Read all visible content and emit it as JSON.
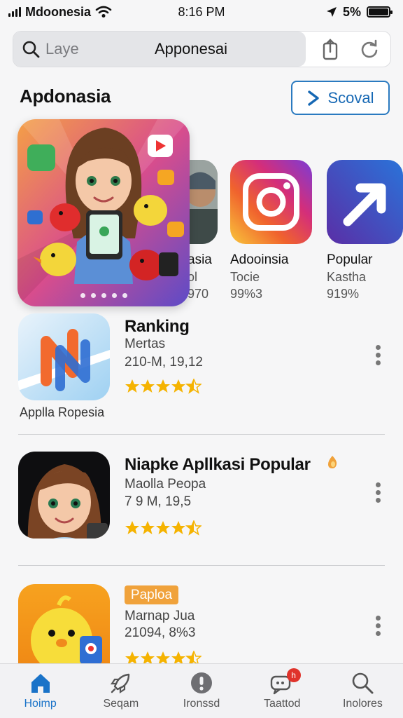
{
  "status_bar": {
    "carrier": "Mdoonesia",
    "time": "8:16 PM",
    "battery": "5%"
  },
  "search": {
    "placeholder": "Laye",
    "title": "Apponesai"
  },
  "section": {
    "title": "Apdonasia",
    "button_label": "Scoval"
  },
  "carousel": {
    "cards": [
      {
        "title": "asia",
        "line2": "ol",
        "line3": "970"
      },
      {
        "title": "Adooinsia",
        "line2": "Tocie",
        "line3": "99%3"
      },
      {
        "title": "Popular",
        "line2": "Kastha",
        "line3": "919%"
      }
    ],
    "page_dots": 5
  },
  "list": {
    "items": [
      {
        "name": "Ranking",
        "subtitle": "Mertas",
        "meta": "210-M, 19,12",
        "rating": 4.5,
        "caption": "Applla Ropesia"
      },
      {
        "name": "Niapke Apllkasi Popular",
        "subtitle": "Maolla Peopa",
        "meta": "7 9 M, 19,5",
        "rating": 4.5
      },
      {
        "name": "",
        "badge": "Paploa",
        "subtitle": "Marnap Jua",
        "meta": "21094, 8%3",
        "rating": 4.5
      }
    ]
  },
  "tabbar": {
    "tabs": [
      {
        "label": "Hoimp",
        "icon": "home-icon",
        "active": true
      },
      {
        "label": "Seqam",
        "icon": "rocket-icon",
        "active": false
      },
      {
        "label": "Ironssd",
        "icon": "info-icon",
        "active": false
      },
      {
        "label": "Taattod",
        "icon": "chat-icon",
        "active": false,
        "badge": "h"
      },
      {
        "label": "Inolores",
        "icon": "search-icon",
        "active": false
      }
    ]
  },
  "colors": {
    "accent": "#1a73c8",
    "star": "#f5b301",
    "badge": "#f0a23b"
  }
}
